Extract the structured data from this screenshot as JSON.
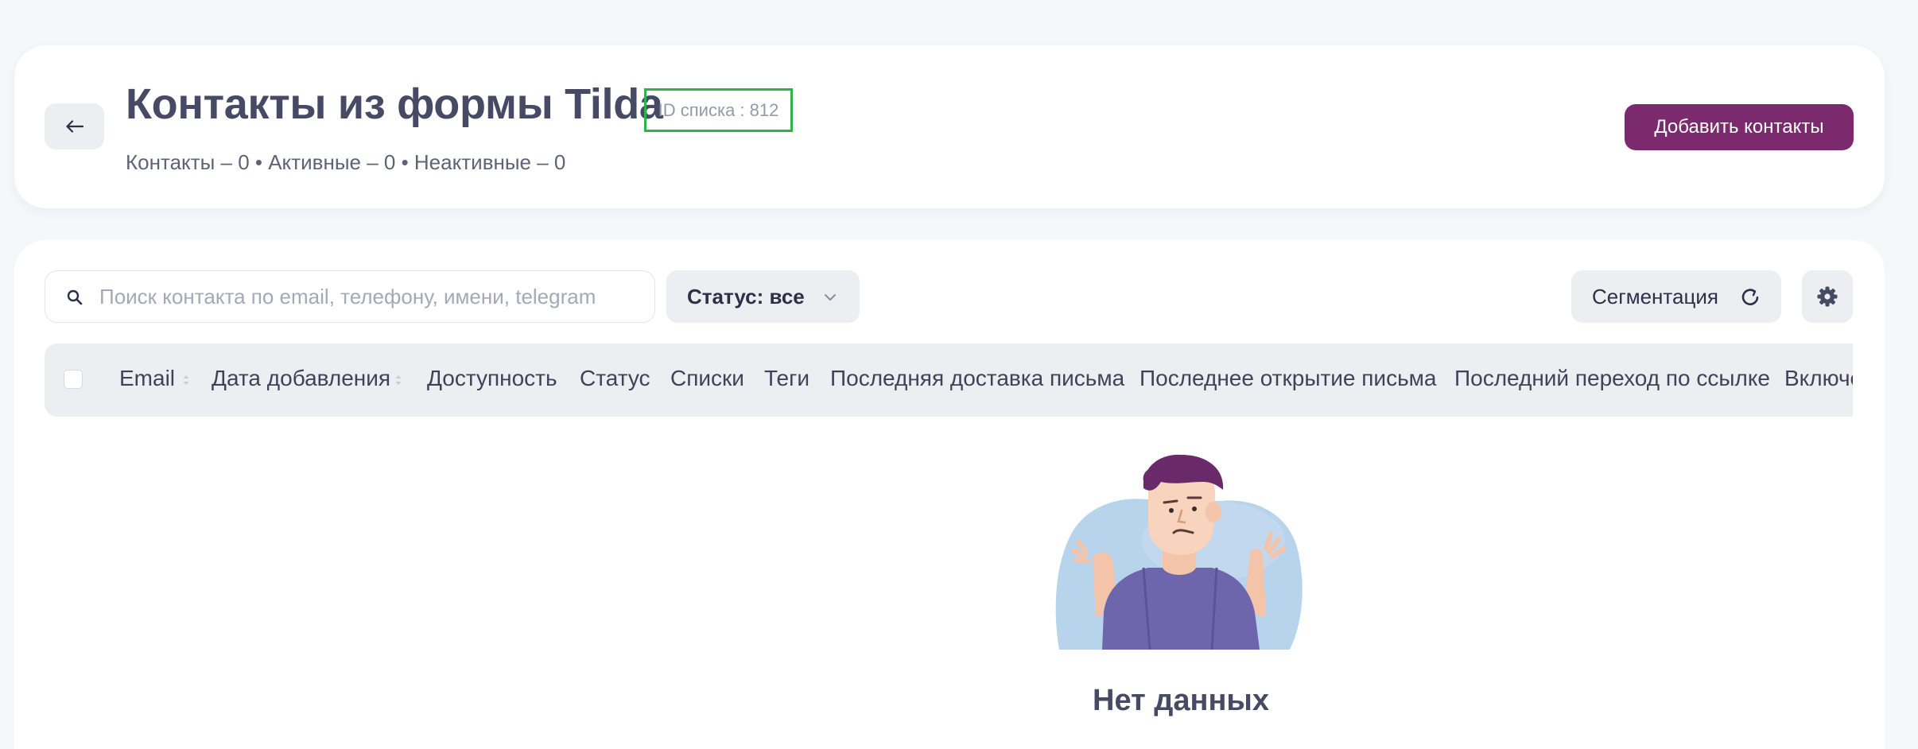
{
  "header": {
    "title": "Контакты из формы Tilda",
    "list_id": "ID списка : 812",
    "stats": "Контакты – 0 • Активные – 0 • Неактивные – 0",
    "add_button": "Добавить контакты"
  },
  "toolbar": {
    "search_placeholder": "Поиск контакта по email, телефону, имени, telegram",
    "status_filter": "Статус: все",
    "segmentation": "Сегментация"
  },
  "table": {
    "columns": [
      "Email",
      "Дата добавления",
      "Доступность",
      "Статус",
      "Списки",
      "Теги",
      "Последняя доставка письма",
      "Последнее открытие письма",
      "Последний переход по ссылке",
      "Включен"
    ]
  },
  "empty_state": {
    "text": "Нет данных"
  },
  "colors": {
    "accent": "#7b2b6d",
    "id_highlight": "#2fb24a",
    "background": "#f6f7f9"
  }
}
